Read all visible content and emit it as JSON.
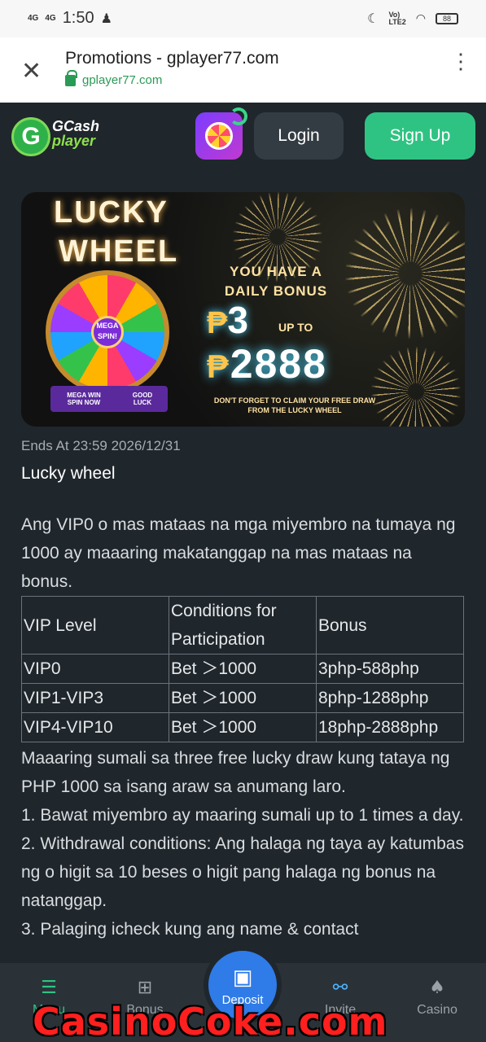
{
  "status_bar": {
    "net1": "4G",
    "net2": "4G",
    "time": "1:50",
    "volte": "Vo)\nLTE2",
    "battery": "88"
  },
  "browser": {
    "title": "Promotions - gplayer77.com",
    "url": "gplayer77.com"
  },
  "header": {
    "logo_line1": "GCash",
    "logo_line2": "player",
    "login_label": "Login",
    "signup_label": "Sign Up"
  },
  "banner": {
    "title_line1": "LUCKY",
    "title_line2": "WHEEL",
    "wheel_center": "MEGA SPIN!",
    "wheel_base_left": "MEGA WIN SPIN NOW",
    "wheel_base_right": "GOOD LUCK",
    "daily_bonus": "YOU HAVE A DAILY BONUS",
    "currency": "₱",
    "min_amount": "3",
    "up_to": "UP TO",
    "max_amount": "2888",
    "note": "DON'T FORGET TO CLAIM YOUR FREE DRAW FROM THE LUCKY WHEEL"
  },
  "promo": {
    "ends_at": "Ends At 23:59 2026/12/31",
    "title": "Lucky wheel",
    "intro": "Ang VIP0 o mas mataas na mga miyembro na tumaya ng 1000 ay maaaring makatanggap na mas mataas na bonus.",
    "table": {
      "headers": [
        "VIP Level",
        "Conditions for Participation",
        "Bonus"
      ],
      "rows": [
        [
          "VIP0",
          "Bet ＞1000",
          "3php-588php"
        ],
        [
          "VIP1-VIP3",
          "Bet ＞1000",
          "8php-1288php"
        ],
        [
          "VIP4-VIP10",
          "Bet ＞1000",
          "18php-2888php"
        ]
      ]
    },
    "after_lines": [
      "Maaaring sumali sa three free lucky draw kung tataya ng PHP 1000 sa isang araw sa anumang laro.",
      "1. Bawat miyembro ay maaring sumali up to 1 times a day.",
      "2. Withdrawal conditions: Ang halaga ng taya ay katumbas ng o higit sa 10 beses o higit pang halaga ng bonus na natanggap.",
      "3. Palaging icheck kung ang name & contact"
    ]
  },
  "bottom_nav": {
    "menu": "Menu",
    "bonus": "Bonus",
    "deposit": "Deposit",
    "invite": "Invite",
    "casino": "Casino"
  },
  "watermark": "CasinoCoke.com",
  "colors": {
    "accent_green": "#2fc383",
    "deposit_blue": "#2f7be8",
    "background": "#1f262c"
  },
  "icons": {
    "browser_close": "close-icon",
    "browser_menu": "more-vert-icon",
    "menu": "menu-icon",
    "bonus": "gift-icon",
    "deposit": "wallet-icon",
    "invite": "share-icon",
    "casino": "cards-icon"
  }
}
